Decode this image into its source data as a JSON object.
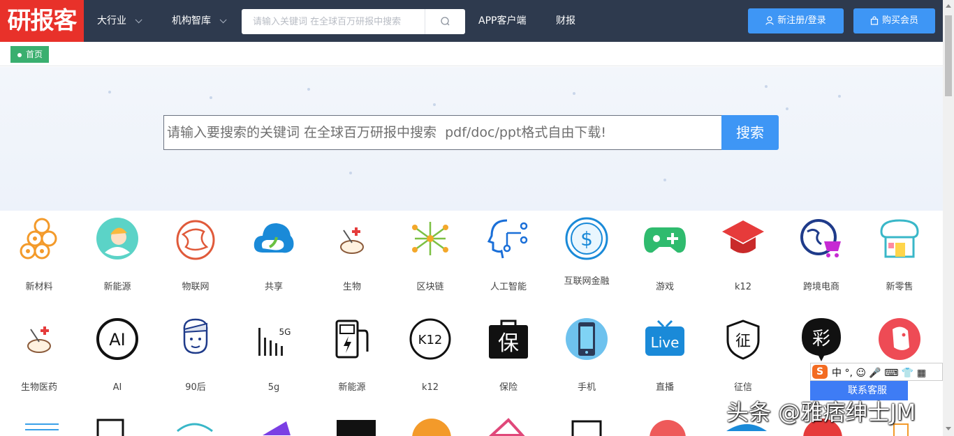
{
  "header": {
    "logo_text": "研报客",
    "nav": [
      {
        "label": "大行业"
      },
      {
        "label": "机构智库"
      },
      {
        "label": "APP客户端"
      },
      {
        "label": "财报"
      }
    ],
    "search": {
      "placeholder": "请输入关键词 在全球百万研报中搜索"
    },
    "register_label": "新注册/登录",
    "buy_label": "购买会员"
  },
  "breadcrumb": {
    "home": "首页"
  },
  "hero": {
    "search_placeholder": "请输入要搜索的关键词 在全球百万研报中搜索  pdf/doc/ppt格式自由下载!",
    "search_button": "搜索"
  },
  "categories_row1": [
    {
      "label": "新材料",
      "icon": "wood-logs-icon"
    },
    {
      "label": "新能源",
      "icon": "worker-icon"
    },
    {
      "label": "物联网",
      "icon": "globe-net-icon"
    },
    {
      "label": "共享",
      "icon": "cloud-icon"
    },
    {
      "label": "生物",
      "icon": "mouse-lab-icon"
    },
    {
      "label": "区块链",
      "icon": "blockchain-icon"
    },
    {
      "label": "人工智能",
      "icon": "ai-head-icon"
    },
    {
      "label": "互联网金融",
      "icon": "dollar-icon"
    },
    {
      "label": "游戏",
      "icon": "gamepad-icon"
    },
    {
      "label": "k12",
      "icon": "graduation-cap-icon"
    },
    {
      "label": "跨境电商",
      "icon": "globe-cart-icon"
    },
    {
      "label": "新零售",
      "icon": "store-icon"
    }
  ],
  "categories_row2": [
    {
      "label": "生物医药",
      "icon": "mouse-lab-icon"
    },
    {
      "label": "AI",
      "icon": "ai-circle-icon"
    },
    {
      "label": "90后",
      "icon": "young-man-icon"
    },
    {
      "label": "5g",
      "icon": "5g-signal-icon"
    },
    {
      "label": "新能源",
      "icon": "charging-station-icon"
    },
    {
      "label": "k12",
      "icon": "k12-circle-icon"
    },
    {
      "label": "保险",
      "icon": "insurance-bag-icon"
    },
    {
      "label": "手机",
      "icon": "phone-icon"
    },
    {
      "label": "直播",
      "icon": "live-tv-icon"
    },
    {
      "label": "征信",
      "icon": "credit-shield-icon"
    },
    {
      "label": "",
      "icon": "lottery-icon"
    },
    {
      "label": "",
      "icon": "dog-icon"
    }
  ],
  "customer_service": "联系客服",
  "ime_bar": "中 °, ☺ 🎤 ⌨ 👕 ▦",
  "watermark": "头条 @雅痞绅士JM",
  "colors": {
    "topbar": "#2e3a4e",
    "logo_bg": "#e8312a",
    "accent": "#3e96f5",
    "home_tag": "#3aaf6f"
  }
}
